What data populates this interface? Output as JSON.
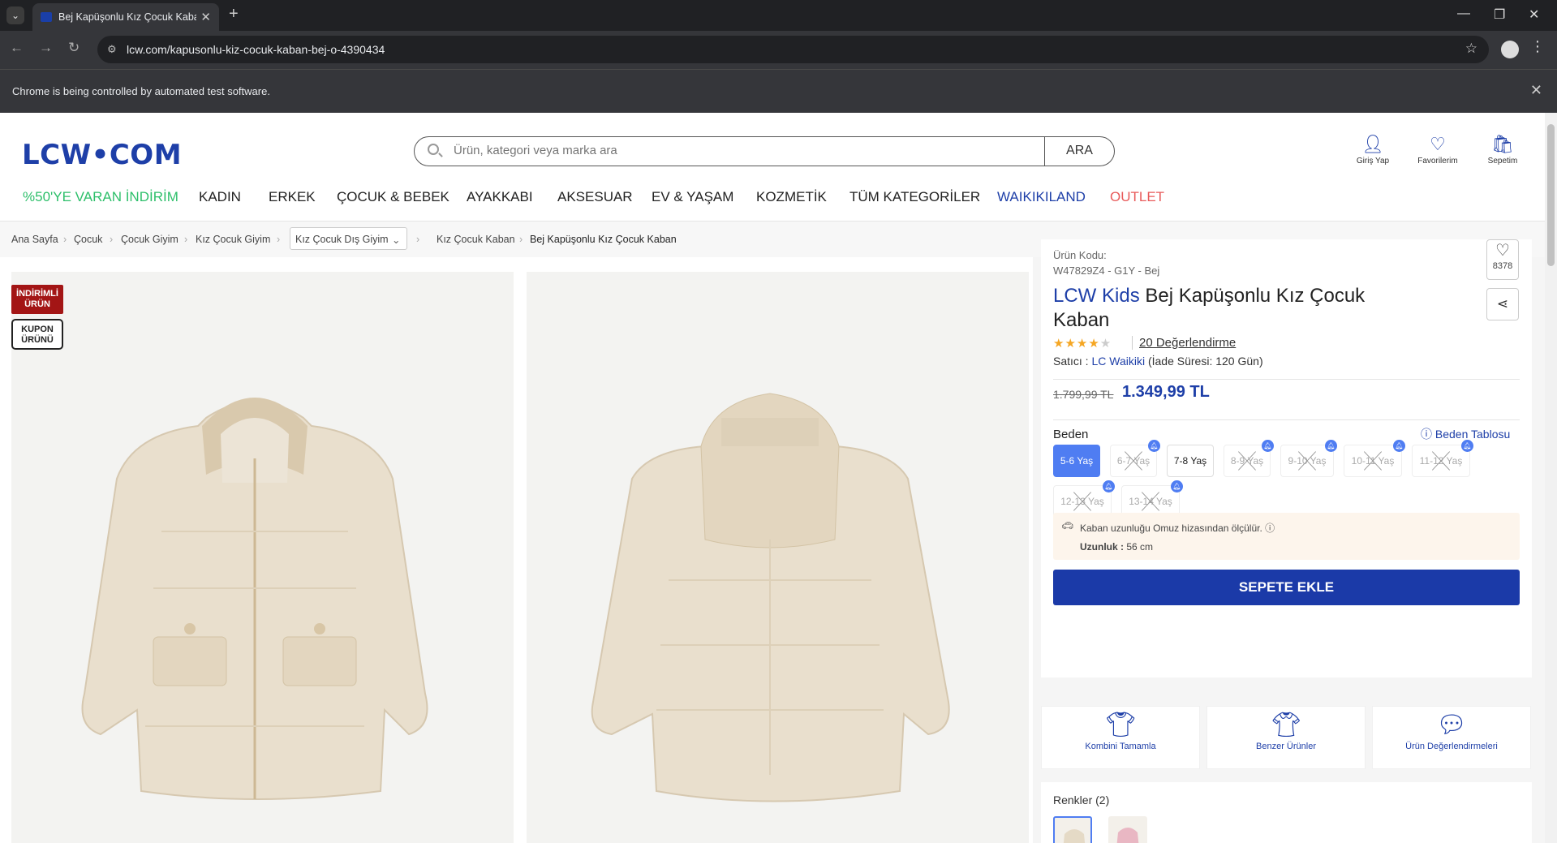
{
  "browser": {
    "tab_title": "Bej Kapüşonlu Kız Çocuk Kaban",
    "url": "lcw.com/kapusonlu-kiz-cocuk-kaban-bej-o-4390434",
    "automation_message": "Chrome is being controlled by automated test software."
  },
  "header": {
    "logo": "LCW•COM",
    "search_placeholder": "Ürün, kategori veya marka ara",
    "search_button": "ARA",
    "actions": [
      {
        "label": "Giriş Yap",
        "icon": "user-icon"
      },
      {
        "label": "Favorilerim",
        "icon": "heart-icon"
      },
      {
        "label": "Sepetim",
        "icon": "bag-icon"
      }
    ]
  },
  "nav": [
    {
      "label": "%50'YE VARAN İNDİRİM",
      "color": "#2dbf6a"
    },
    {
      "label": "KADIN",
      "color": "#222222"
    },
    {
      "label": "ERKEK",
      "color": "#222222"
    },
    {
      "label": "ÇOCUK & BEBEK",
      "color": "#222222"
    },
    {
      "label": "AYAKKABI",
      "color": "#222222"
    },
    {
      "label": "AKSESUAR",
      "color": "#222222"
    },
    {
      "label": "EV & YAŞAM",
      "color": "#222222"
    },
    {
      "label": "KOZMETİK",
      "color": "#222222"
    },
    {
      "label": "TÜM KATEGORİLER",
      "color": "#222222"
    },
    {
      "label": "WAIKIKILAND",
      "color": "#1e3fa8"
    },
    {
      "label": "OUTLET",
      "color": "#e85a5a"
    }
  ],
  "breadcrumb": [
    "Ana Sayfa",
    "Çocuk",
    "Çocuk Giyim",
    "Kız Çocuk Giyim",
    "Kız Çocuk Dış Giyim",
    "Kız Çocuk Kaban",
    "Bej Kapüşonlu Kız Çocuk Kaban"
  ],
  "badges": {
    "discount": "İNDİRİMLİ ÜRÜN",
    "coupon": "KUPON ÜRÜNÜ"
  },
  "product": {
    "code_label": "Ürün Kodu:",
    "code": "W47829Z4 - G1Y - Bej",
    "brand": "LCW Kids",
    "name": "Bej Kapüşonlu Kız Çocuk Kaban",
    "favorites_count": "8378",
    "rating": 4,
    "rating_text": "20 Değerlendirme",
    "seller_label": "Satıcı :",
    "seller": "LC Waikiki",
    "return_info": "(İade Süresi: 120 Gün)",
    "old_price": "1.799,99 TL",
    "price": "1.349,99 TL",
    "size_label": "Beden",
    "size_chart": "Beden Tablosu",
    "sizes": [
      {
        "label": "5-6 Yaş",
        "state": "selected"
      },
      {
        "label": "6-7 Yaş",
        "state": "soldout"
      },
      {
        "label": "7-8 Yaş",
        "state": "available"
      },
      {
        "label": "8-9 Yaş",
        "state": "soldout"
      },
      {
        "label": "9-10 Yaş",
        "state": "soldout"
      },
      {
        "label": "10-11 Yaş",
        "state": "soldout"
      },
      {
        "label": "11-12 Yaş",
        "state": "soldout"
      },
      {
        "label": "12-13 Yaş",
        "state": "soldout"
      },
      {
        "label": "13-14 Yaş",
        "state": "soldout"
      }
    ],
    "measure_note": "Kaban uzunluğu Omuz hizasından ölçülür.",
    "length_label": "Uzunluk :",
    "length_value": "56 cm",
    "add_to_cart": "SEPETE EKLE"
  },
  "features": [
    {
      "label": "Kombini Tamamla",
      "icon": "outfit-icon"
    },
    {
      "label": "Benzer Ürünler",
      "icon": "tshirt-icon"
    },
    {
      "label": "Ürün Değerlendirmeleri",
      "icon": "review-icon"
    }
  ],
  "colors": {
    "title": "Renkler (2)",
    "swatches": [
      {
        "color": "#e8dfcf",
        "selected": true
      },
      {
        "color": "#e9b7c3",
        "selected": false
      }
    ]
  }
}
